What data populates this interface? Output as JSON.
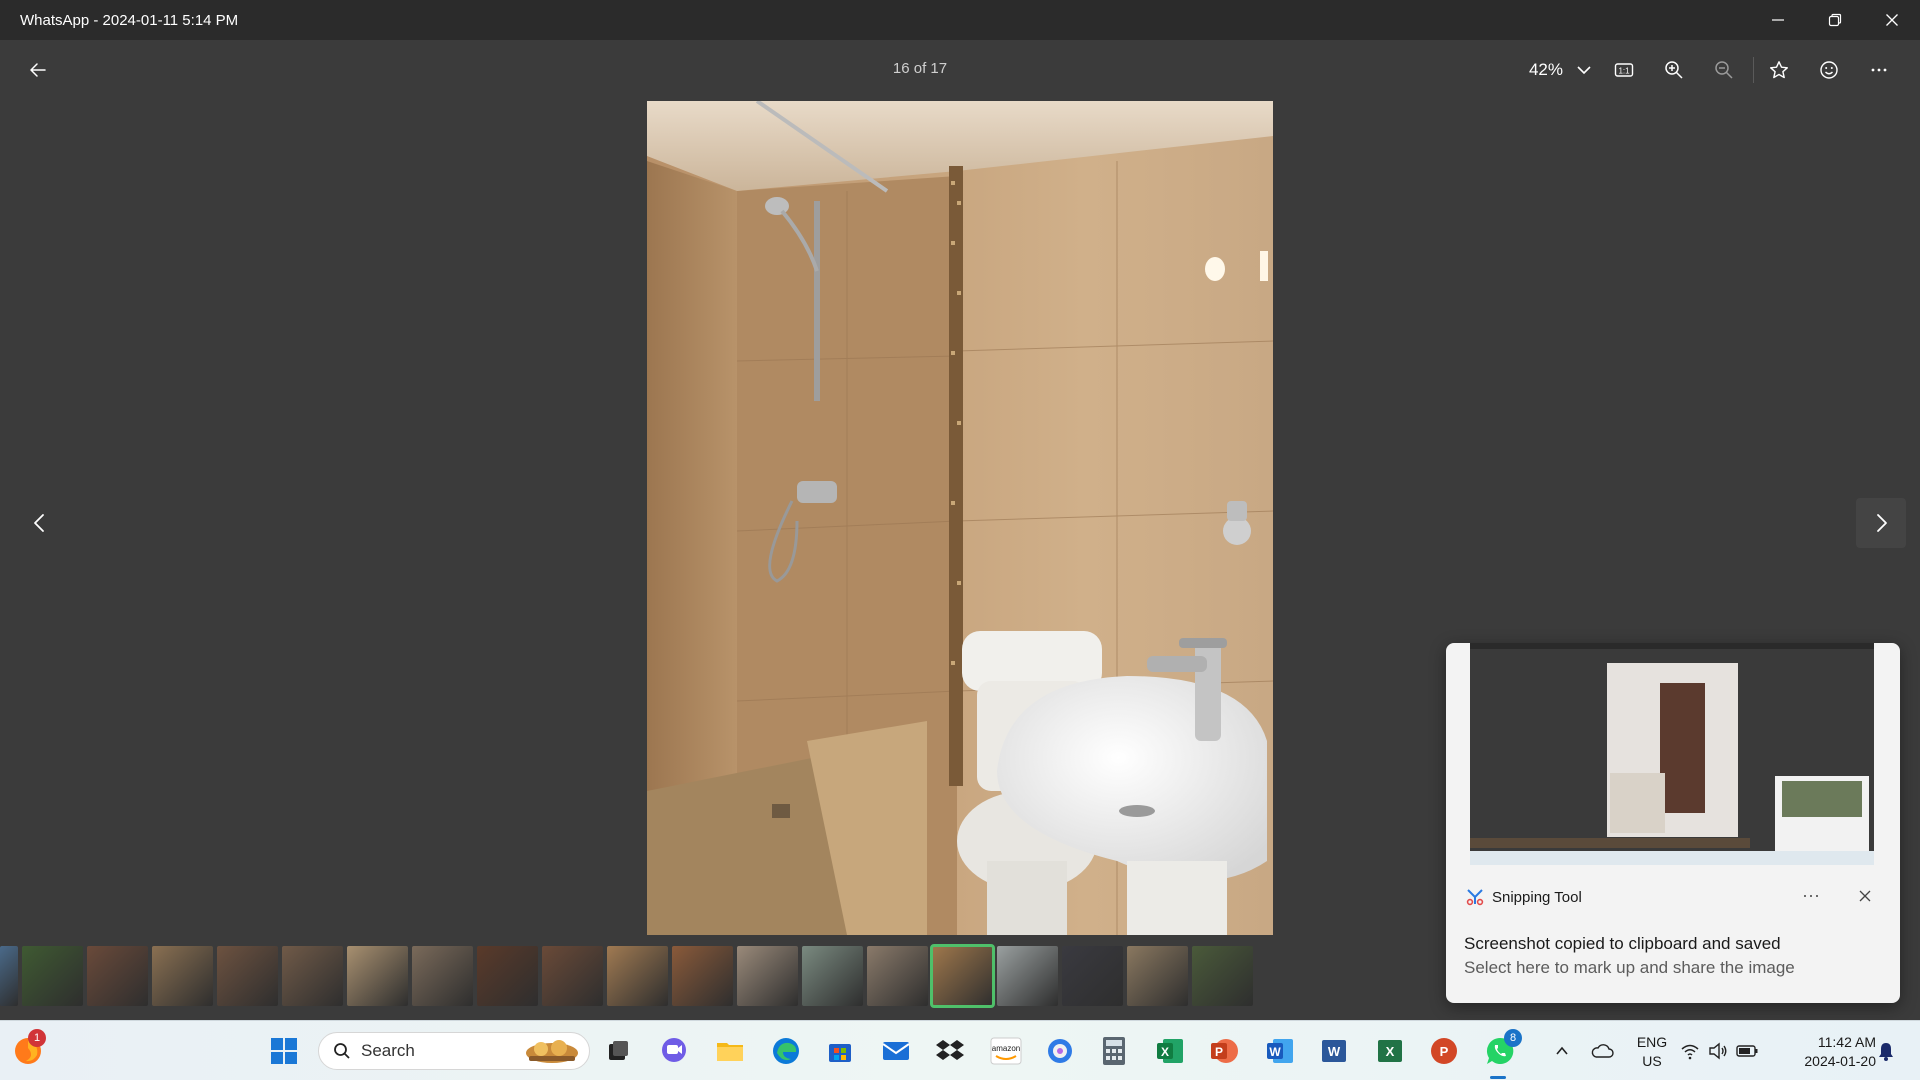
{
  "window": {
    "title": "WhatsApp - 2024-01-11 5:14 PM",
    "controls": [
      "minimize-icon",
      "restore-icon",
      "close-icon"
    ]
  },
  "viewer": {
    "counter": "16 of 17",
    "zoom": "42%",
    "tools": [
      "actual-size-icon",
      "zoom-in-icon",
      "zoom-out-icon",
      "star-icon",
      "emoji-icon",
      "more-icon"
    ]
  },
  "filmstrip": {
    "count": 20,
    "active_index": 15,
    "colors": [
      "#4a6a8a",
      "#3f5a32",
      "#6a4a3a",
      "#8a7052",
      "#6d5240",
      "#705a48",
      "#a89070",
      "#7a6a5a",
      "#5a3a2a",
      "#6a4a38",
      "#a07a52",
      "#8a5a3a",
      "#9a8a7a",
      "#7a8a80",
      "#8a7a6a",
      "#a0784c",
      "#9aa0a0",
      "#3a3a40",
      "#8a7860",
      "#4a5a3a"
    ]
  },
  "toast": {
    "app_name": "Snipping Tool",
    "title": "Screenshot copied to clipboard and saved",
    "body": "Select here to mark up and share the image"
  },
  "taskbar": {
    "search_placeholder": "Search",
    "firefox_badge": "1",
    "whatsapp_badge": "8",
    "lang_line1": "ENG",
    "lang_line2": "US",
    "time": "11:42 AM",
    "date": "2024-01-20",
    "apps": [
      "start-icon",
      "task-view-icon",
      "meet-icon",
      "file-explorer-icon",
      "edge-icon",
      "store-icon",
      "mail-icon",
      "dropbox-icon",
      "amazon-icon",
      "copilot-icon",
      "calculator-icon",
      "excel-icon",
      "powerpoint-icon",
      "word-icon",
      "word-icon",
      "excel-icon",
      "powerpoint-icon",
      "whatsapp-icon"
    ]
  },
  "accent": "#4fc06a"
}
